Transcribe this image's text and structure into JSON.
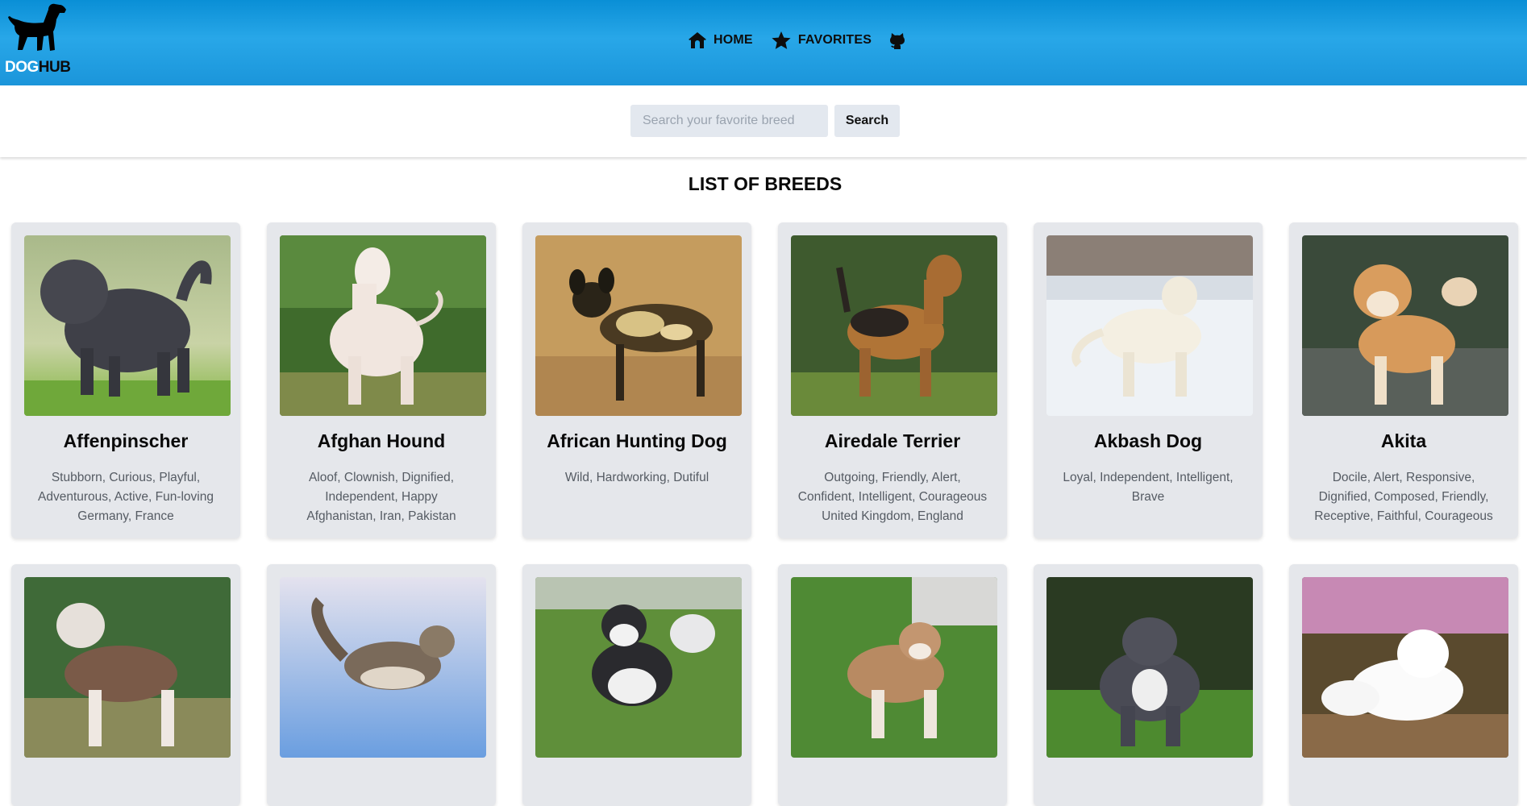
{
  "brand": {
    "part1": "DOG",
    "part2": "HUB"
  },
  "nav": {
    "home_label": "HOME",
    "favorites_label": "FAVORITES",
    "github_icon": "github-icon"
  },
  "search": {
    "placeholder": "Search your favorite breed",
    "value": "",
    "button_label": "Search"
  },
  "list_title": "LIST OF BREEDS",
  "breeds": [
    {
      "name": "Affenpinscher",
      "temperament": "Stubborn, Curious, Playful, Adventurous, Active, Fun-loving",
      "origin": "Germany, France"
    },
    {
      "name": "Afghan Hound",
      "temperament": "Aloof, Clownish, Dignified, Independent, Happy",
      "origin": "Afghanistan, Iran, Pakistan"
    },
    {
      "name": "African Hunting Dog",
      "temperament": "Wild, Hardworking, Dutiful",
      "origin": ""
    },
    {
      "name": "Airedale Terrier",
      "temperament": "Outgoing, Friendly, Alert, Confident, Intelligent, Courageous",
      "origin": "United Kingdom, England"
    },
    {
      "name": "Akbash Dog",
      "temperament": "Loyal, Independent, Intelligent, Brave",
      "origin": ""
    },
    {
      "name": "Akita",
      "temperament": "Docile, Alert, Responsive, Dignified, Composed, Friendly, Receptive, Faithful, Courageous",
      "origin": ""
    },
    {
      "name": "",
      "temperament": "",
      "origin": ""
    },
    {
      "name": "",
      "temperament": "",
      "origin": ""
    },
    {
      "name": "",
      "temperament": "",
      "origin": ""
    },
    {
      "name": "",
      "temperament": "",
      "origin": ""
    },
    {
      "name": "",
      "temperament": "",
      "origin": ""
    },
    {
      "name": "",
      "temperament": "",
      "origin": ""
    }
  ],
  "colors": {
    "header_top": "#0a8fd6",
    "header_mid": "#28a7e8",
    "card_bg": "#e5e7eb",
    "input_bg": "#e3e8ef"
  }
}
